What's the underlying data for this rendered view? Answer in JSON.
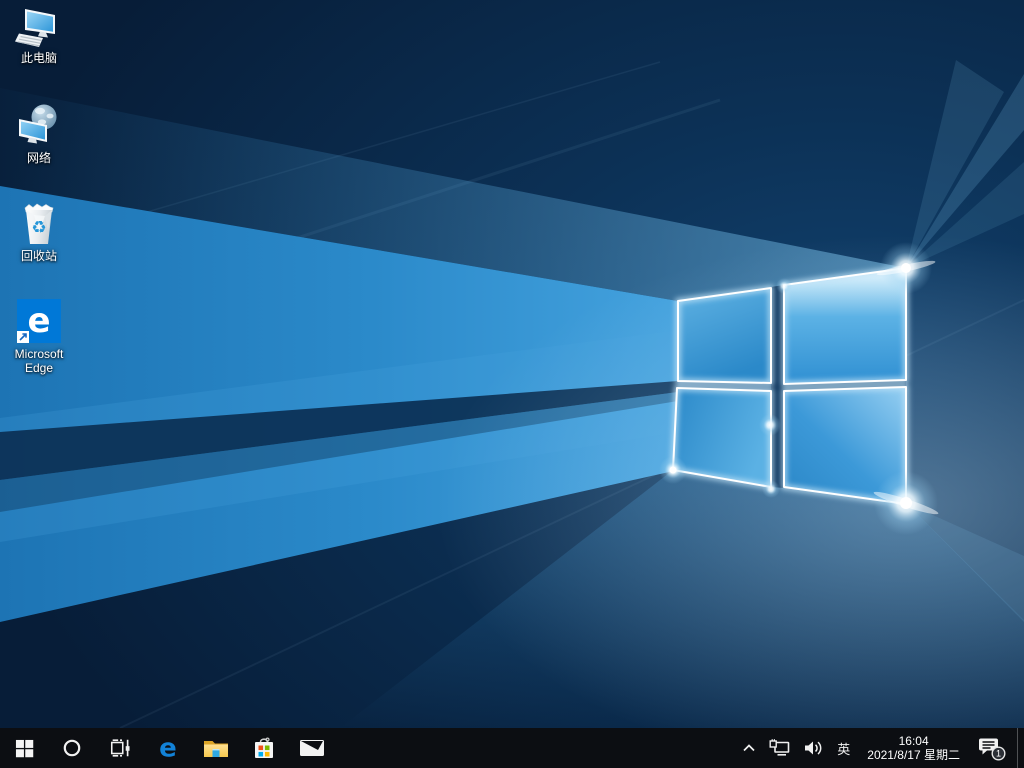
{
  "desktop": {
    "icons": [
      {
        "id": "this-pc",
        "label": "此电脑"
      },
      {
        "id": "network",
        "label": "网络"
      },
      {
        "id": "recycle-bin",
        "label": "回收站"
      },
      {
        "id": "microsoft-edge",
        "label": "Microsoft Edge"
      }
    ]
  },
  "taskbar": {
    "buttons": [
      {
        "name": "start"
      },
      {
        "name": "search"
      },
      {
        "name": "task-view"
      },
      {
        "name": "microsoft-edge"
      },
      {
        "name": "file-explorer"
      },
      {
        "name": "microsoft-store"
      },
      {
        "name": "mail"
      }
    ],
    "tray": {
      "language": "英",
      "time": "16:04",
      "date": "2021/8/17 星期二",
      "notification_count": "1"
    }
  },
  "colors": {
    "taskbar_bg": "#0c0e12",
    "accent_blue": "#0078d7",
    "wallpaper_deep": "#07203d",
    "wallpaper_beam": "#2b8aca",
    "store_red": "#f1511b",
    "store_green": "#7fba00",
    "store_blue": "#00adef",
    "store_yellow": "#ffb900"
  }
}
